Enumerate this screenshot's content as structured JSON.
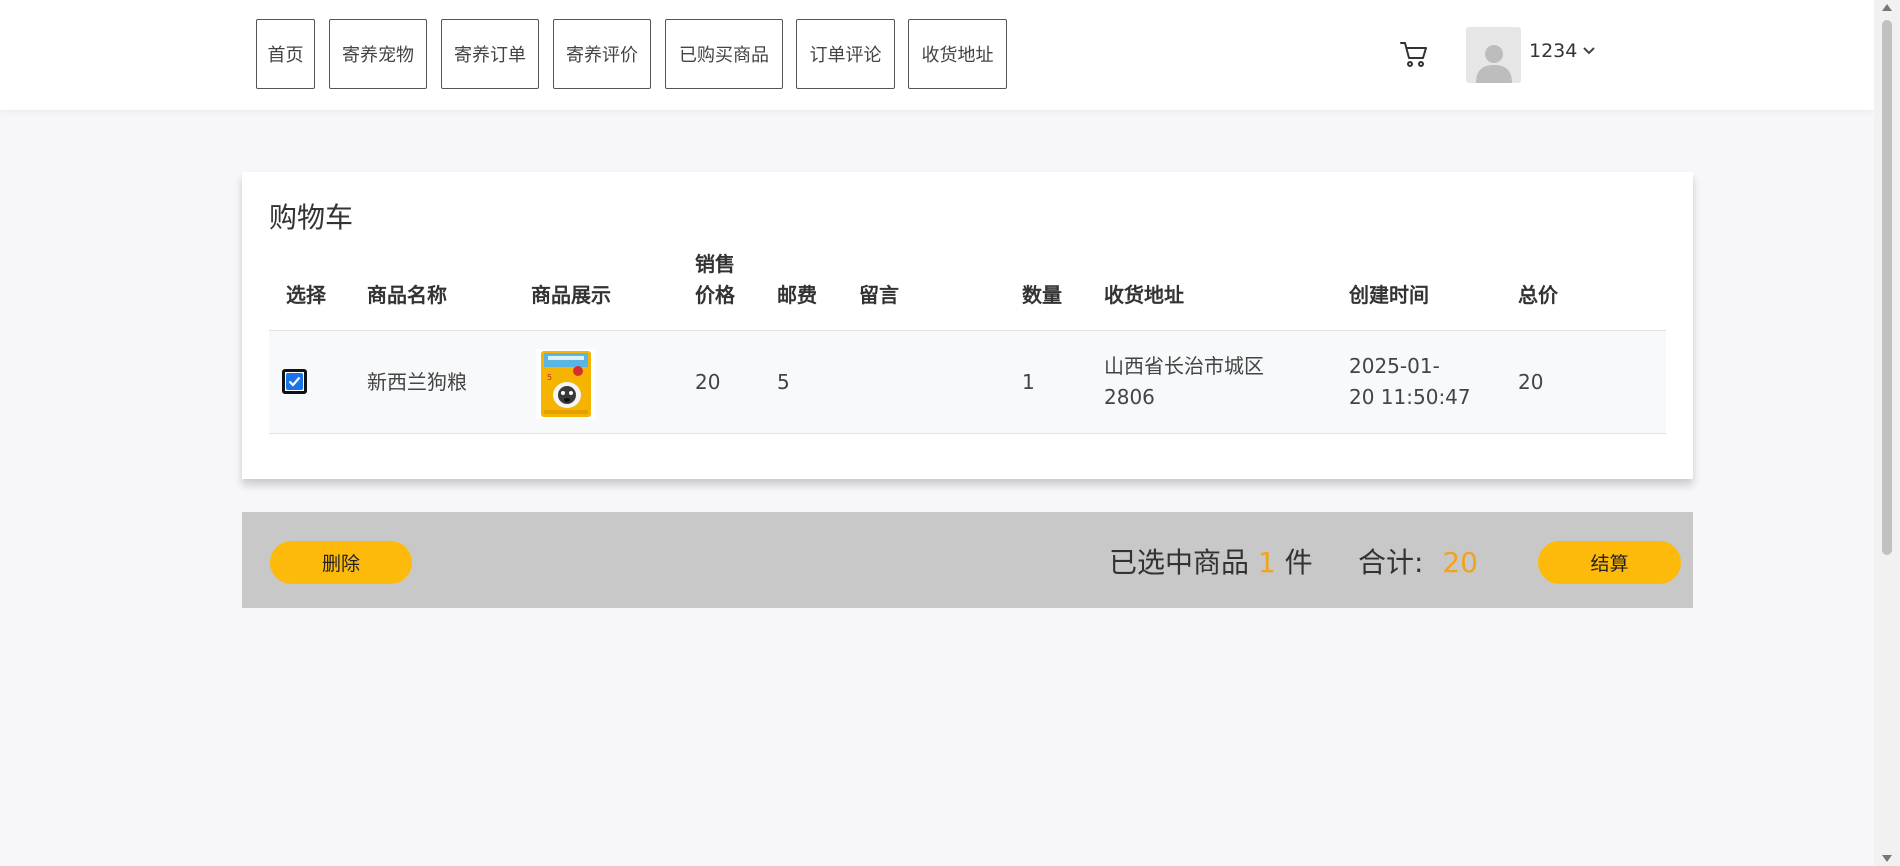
{
  "nav": {
    "items": [
      "首页",
      "寄养宠物",
      "寄养订单",
      "寄养评价",
      "已购买商品",
      "订单评论",
      "收货地址"
    ]
  },
  "user": {
    "name": "1234"
  },
  "cart": {
    "title": "购物车",
    "headers": {
      "select": "选择",
      "name": "商品名称",
      "image": "商品展示",
      "price_line1": "销售",
      "price_line2": "价格",
      "postage": "邮费",
      "message": "留言",
      "quantity": "数量",
      "address": "收货地址",
      "created": "创建时间",
      "total": "总价"
    },
    "rows": [
      {
        "checked": true,
        "name": "新西兰狗粮",
        "price": "20",
        "postage": "5",
        "message": "",
        "quantity": "1",
        "address_line1": "山西省长治市城区",
        "address_line2": "2806",
        "created_line1": "2025-01-",
        "created_line2": "20 11:50:47",
        "total": "20"
      }
    ]
  },
  "footer": {
    "delete_label": "删除",
    "selected_prefix": "已选中商品",
    "selected_count": "1",
    "selected_suffix": "件",
    "total_label": "合计:",
    "total_value": "20",
    "checkout_label": "结算"
  },
  "colors": {
    "accent": "#fdba0b",
    "highlight": "#f0a31c",
    "checkbox": "#1a73e8",
    "bar": "#c8c8c8"
  }
}
